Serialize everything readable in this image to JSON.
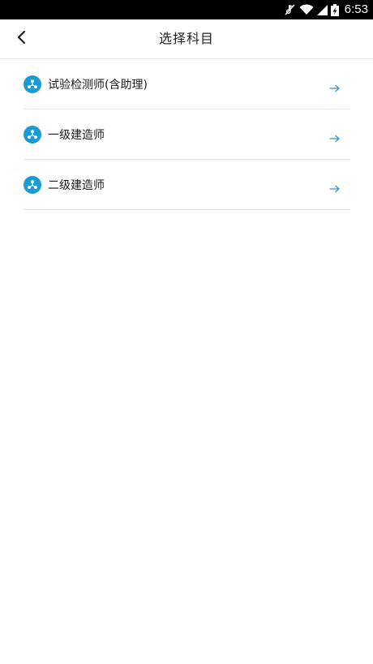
{
  "status_bar": {
    "time": "6:53",
    "icons": [
      "mute-icon",
      "wifi-icon",
      "signal-icon",
      "battery-charging-icon"
    ]
  },
  "header": {
    "title": "选择科目",
    "back_icon": "back-chevron-icon"
  },
  "subjects": [
    {
      "label": "试验检测师(含助理)",
      "icon": "subject-icon",
      "arrow": "arrow-right-icon"
    },
    {
      "label": "一级建造师",
      "icon": "subject-icon",
      "arrow": "arrow-right-icon"
    },
    {
      "label": "二级建造师",
      "icon": "subject-icon",
      "arrow": "arrow-right-icon"
    }
  ],
  "colors": {
    "accent": "#1a9bd2",
    "arrow": "#3a8fd8",
    "divider": "#e6e6e6",
    "status_bar": "#000000"
  }
}
